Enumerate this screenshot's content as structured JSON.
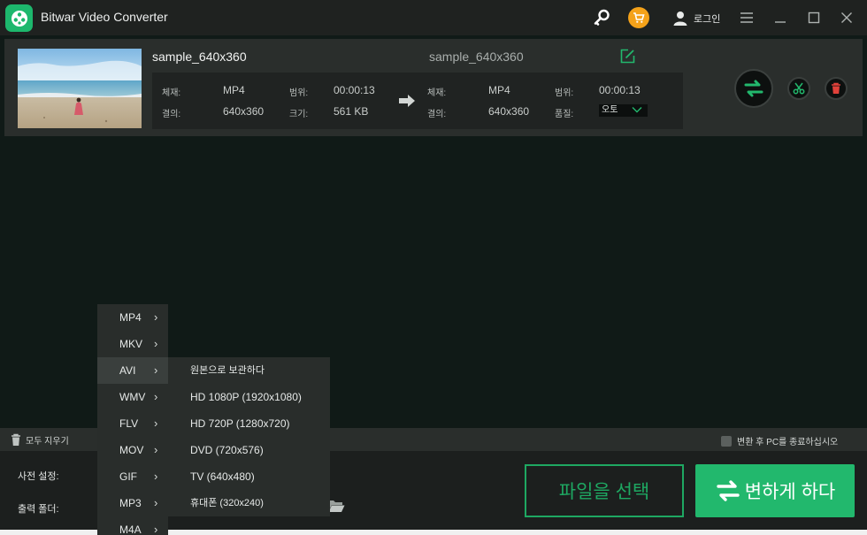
{
  "app": {
    "title": "Bitwar Video Converter",
    "login_label": "로그인"
  },
  "file": {
    "source_name": "sample_640x360",
    "target_name": "sample_640x360",
    "source": {
      "format_label": "체재:",
      "format": "MP4",
      "range_label": "범위:",
      "range": "00:00:13",
      "resolution_label": "결의:",
      "resolution": "640x360",
      "size_label": "크기:",
      "size": "561 KB"
    },
    "target": {
      "format_label": "체재:",
      "format": "MP4",
      "range_label": "범위:",
      "range": "00:00:13",
      "resolution_label": "결의:",
      "resolution": "640x360",
      "quality_label": "품질:",
      "quality": "오토"
    }
  },
  "toolbar": {
    "clear_all": "모두 지우기",
    "shutdown_after": "변환 후 PC를 종료하십시오"
  },
  "bottom": {
    "preset_label": "사전 설정:",
    "output_folder_label": "출력 폴더:",
    "select_file_button": "파일을 선택",
    "convert_button": "변하게 하다"
  },
  "format_menu": {
    "items": [
      "MP4",
      "MKV",
      "AVI",
      "WMV",
      "FLV",
      "MOV",
      "GIF",
      "MP3",
      "M4A"
    ],
    "selected": "AVI"
  },
  "sub_menu": {
    "items": [
      "원본으로 보관하다",
      "HD 1080P (1920x1080)",
      "HD 720P (1280x720)",
      "DVD (720x576)",
      "TV (640x480)",
      "휴대폰 (320x240)"
    ]
  },
  "colors": {
    "accent": "#22b86d",
    "cart": "#f4a219",
    "delete": "#e0413a"
  }
}
